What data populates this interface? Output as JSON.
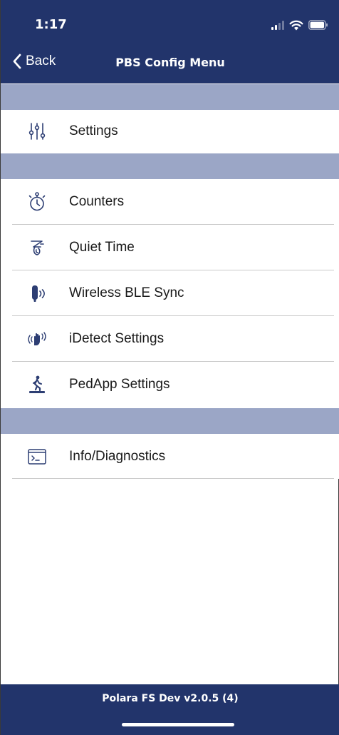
{
  "status_bar": {
    "time": "1:17",
    "signal_icon": "cellular-signal-icon",
    "wifi_icon": "wifi-icon",
    "battery_icon": "battery-icon"
  },
  "nav": {
    "back_label": "Back",
    "title": "PBS Config Menu"
  },
  "menu": {
    "settings": {
      "label": "Settings",
      "icon": "sliders-icon"
    },
    "counters": {
      "label": "Counters",
      "icon": "stopwatch-icon"
    },
    "quiet_time": {
      "label": "Quiet Time",
      "icon": "quiet-time-icon"
    },
    "wireless_ble_sync": {
      "label": "Wireless BLE Sync",
      "icon": "ble-device-icon"
    },
    "idetect_settings": {
      "label": "iDetect Settings",
      "icon": "hand-wave-icon"
    },
    "pedapp_settings": {
      "label": "PedApp Settings",
      "icon": "pedestrian-icon"
    },
    "info_diagnostics": {
      "label": "Info/Diagnostics",
      "icon": "terminal-icon"
    }
  },
  "footer": {
    "version_text": "Polara FS Dev v2.0.5 (4)"
  },
  "colors": {
    "nav_bar": "#22346b",
    "section_header": "#9ba6c6",
    "icon": "#2d3e73"
  }
}
